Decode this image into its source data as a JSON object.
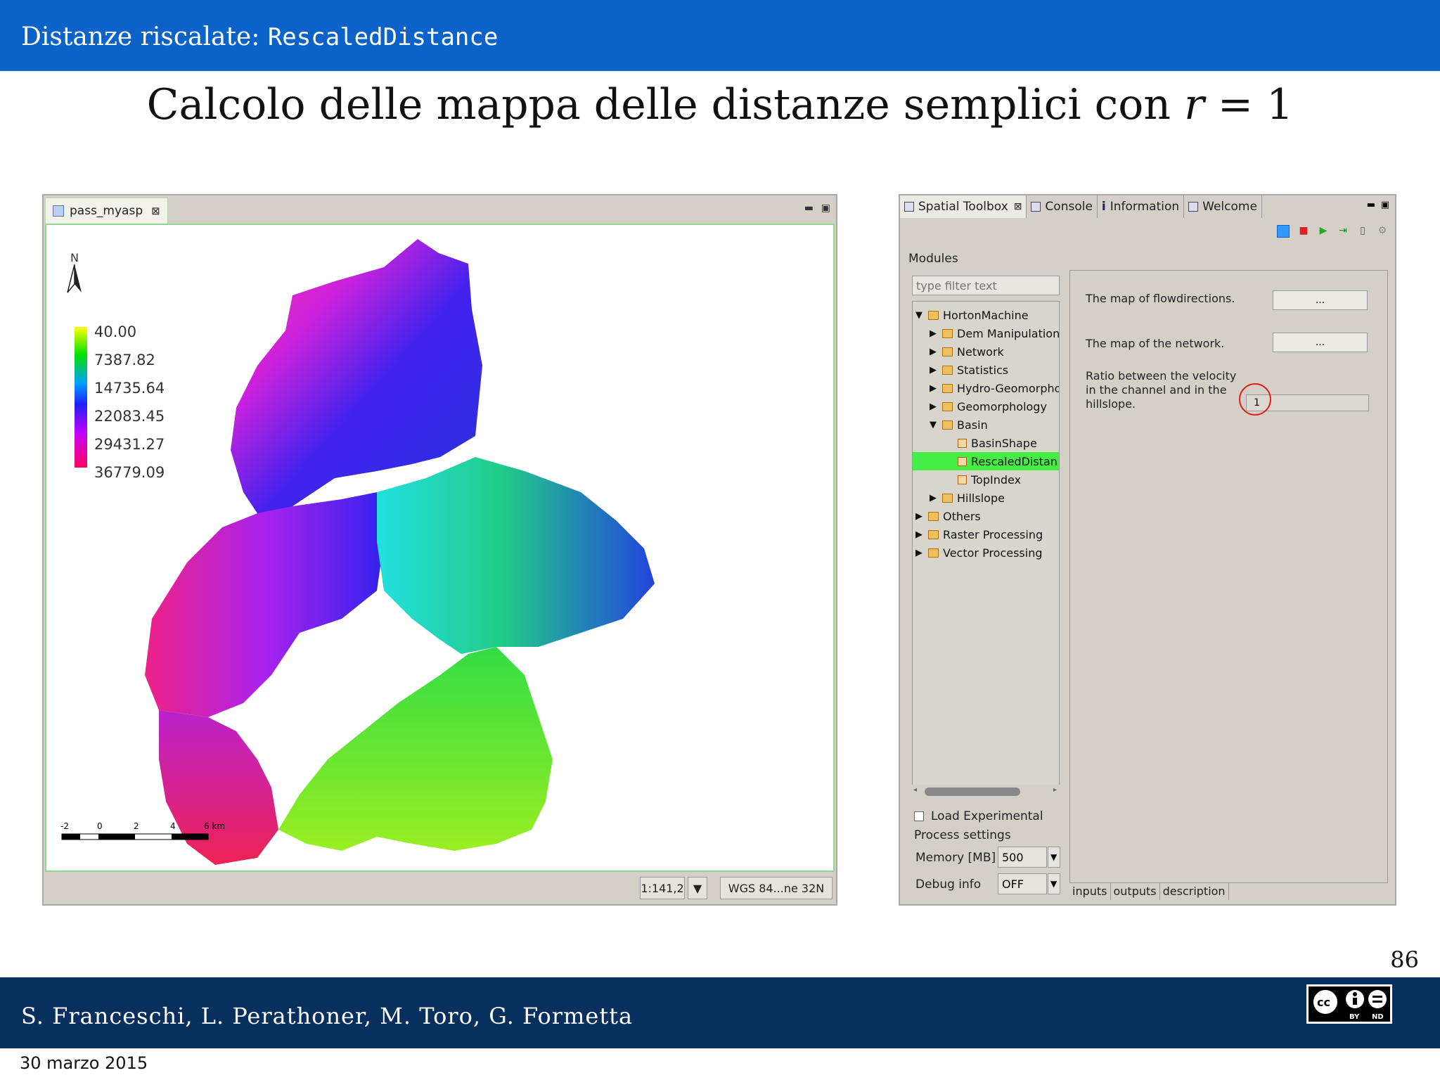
{
  "slide": {
    "title_prefix": "Distanze riscalate: ",
    "title_code": "RescaledDistance",
    "subtitle_text": "Calcolo delle mappa delle distanze semplici con ",
    "subtitle_var": "r",
    "subtitle_eq": " = 1",
    "page_number": "86",
    "authors": "S. Franceschi, L. Perathoner, M. Toro, G. Formetta",
    "date": "30 marzo 2015",
    "license_icons": [
      "cc-icon",
      "by-icon",
      "nd-icon"
    ],
    "license_small": [
      "BY",
      "ND"
    ]
  },
  "map_window": {
    "tab_label": "pass_myasp",
    "north_label": "N",
    "legend": [
      "40.00",
      "7387.82",
      "14735.64",
      "22083.45",
      "29431.27",
      "36779.09"
    ],
    "scale_labels": [
      "-2",
      "0",
      "2",
      "4",
      "6 km"
    ],
    "scale_value": "1:141,2",
    "crs": "WGS 84...ne 32N"
  },
  "toolbox": {
    "tabs": [
      "Spatial Toolbox",
      "Console",
      "Information",
      "Welcome"
    ],
    "modules_label": "Modules",
    "filter_placeholder": "type filter text",
    "tree": [
      {
        "label": "HortonMachine",
        "type": "folder",
        "expanded": true
      },
      {
        "label": "Dem Manipulation",
        "type": "folder"
      },
      {
        "label": "Network",
        "type": "folder"
      },
      {
        "label": "Statistics",
        "type": "folder"
      },
      {
        "label": "Hydro-Geomorpho",
        "type": "folder"
      },
      {
        "label": "Geomorphology",
        "type": "folder"
      },
      {
        "label": "Basin",
        "type": "folder",
        "expanded": true
      },
      {
        "label": "BasinShape",
        "type": "module"
      },
      {
        "label": "RescaledDistan",
        "type": "module",
        "selected": true
      },
      {
        "label": "TopIndex",
        "type": "module"
      },
      {
        "label": "Hillslope",
        "type": "folder"
      },
      {
        "label": "Others",
        "type": "folder"
      },
      {
        "label": "Raster Processing",
        "type": "folder"
      },
      {
        "label": "Vector Processing",
        "type": "folder"
      }
    ],
    "load_experimental": "Load Experimental",
    "process_settings": "Process settings",
    "memory_label": "Memory [MB]",
    "memory_value": "500",
    "debug_label": "Debug info",
    "debug_value": "OFF",
    "param1_label": "The map of flowdirections.",
    "param2_label": "The map of the network.",
    "param3_line1": "Ratio between the velocity",
    "param3_line2": "in the channel and in the",
    "param3_line3": "hillslope.",
    "browse_label": "...",
    "ratio_value": "1",
    "bottom_tabs": [
      "inputs",
      "outputs",
      "description"
    ]
  },
  "colors": {
    "header_bar": "#0b63c9",
    "footer_bar": "#08305e",
    "selected_tree_item": "#44ee44",
    "highlight_circle": "#e02020"
  }
}
